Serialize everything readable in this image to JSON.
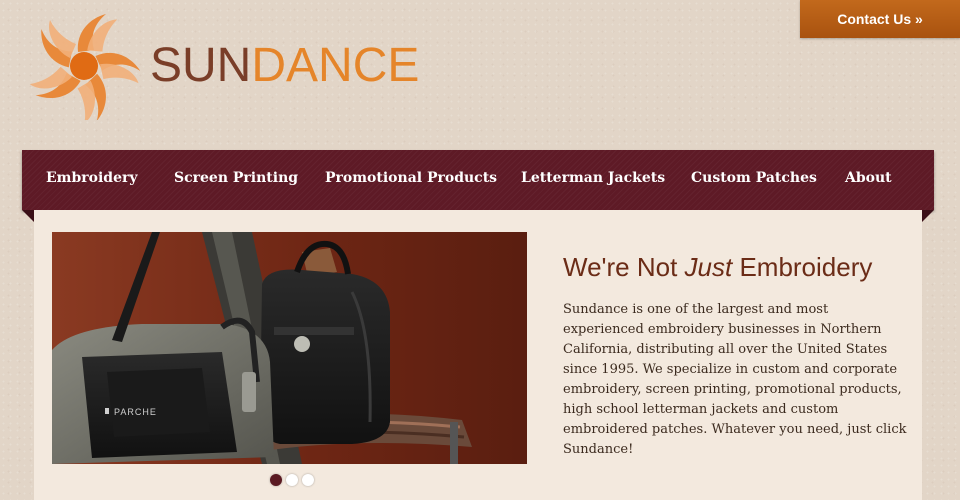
{
  "header": {
    "contact_label": "Contact Us »",
    "logo": {
      "sun": "SUN",
      "dance": "DANCE",
      "icon": "sun-swirl-icon"
    }
  },
  "nav": {
    "items": [
      "Embroidery",
      "Screen Printing",
      "Promotional Products",
      "Letterman Jackets",
      "Custom Patches",
      "About"
    ]
  },
  "hero": {
    "headline_before": "We're Not ",
    "headline_emphasis": "Just",
    "headline_after": " Embroidery",
    "body": "Sundance is one of the largest and most experienced embroidery businesses in Northern California, distributing all over the United States since 1995. We specialize in custom and corporate embroidery, screen printing, promotional products, high school letterman jackets and custom embroidered patches. Whatever you need, just click Sundance!",
    "image_label": "PARCHE",
    "slides": 3,
    "active_slide": 1
  },
  "colors": {
    "accent_orange": "#e5852a",
    "nav_maroon": "#5e1a26",
    "contact_button": "#b85c15",
    "panel_bg": "#f3e9de"
  }
}
